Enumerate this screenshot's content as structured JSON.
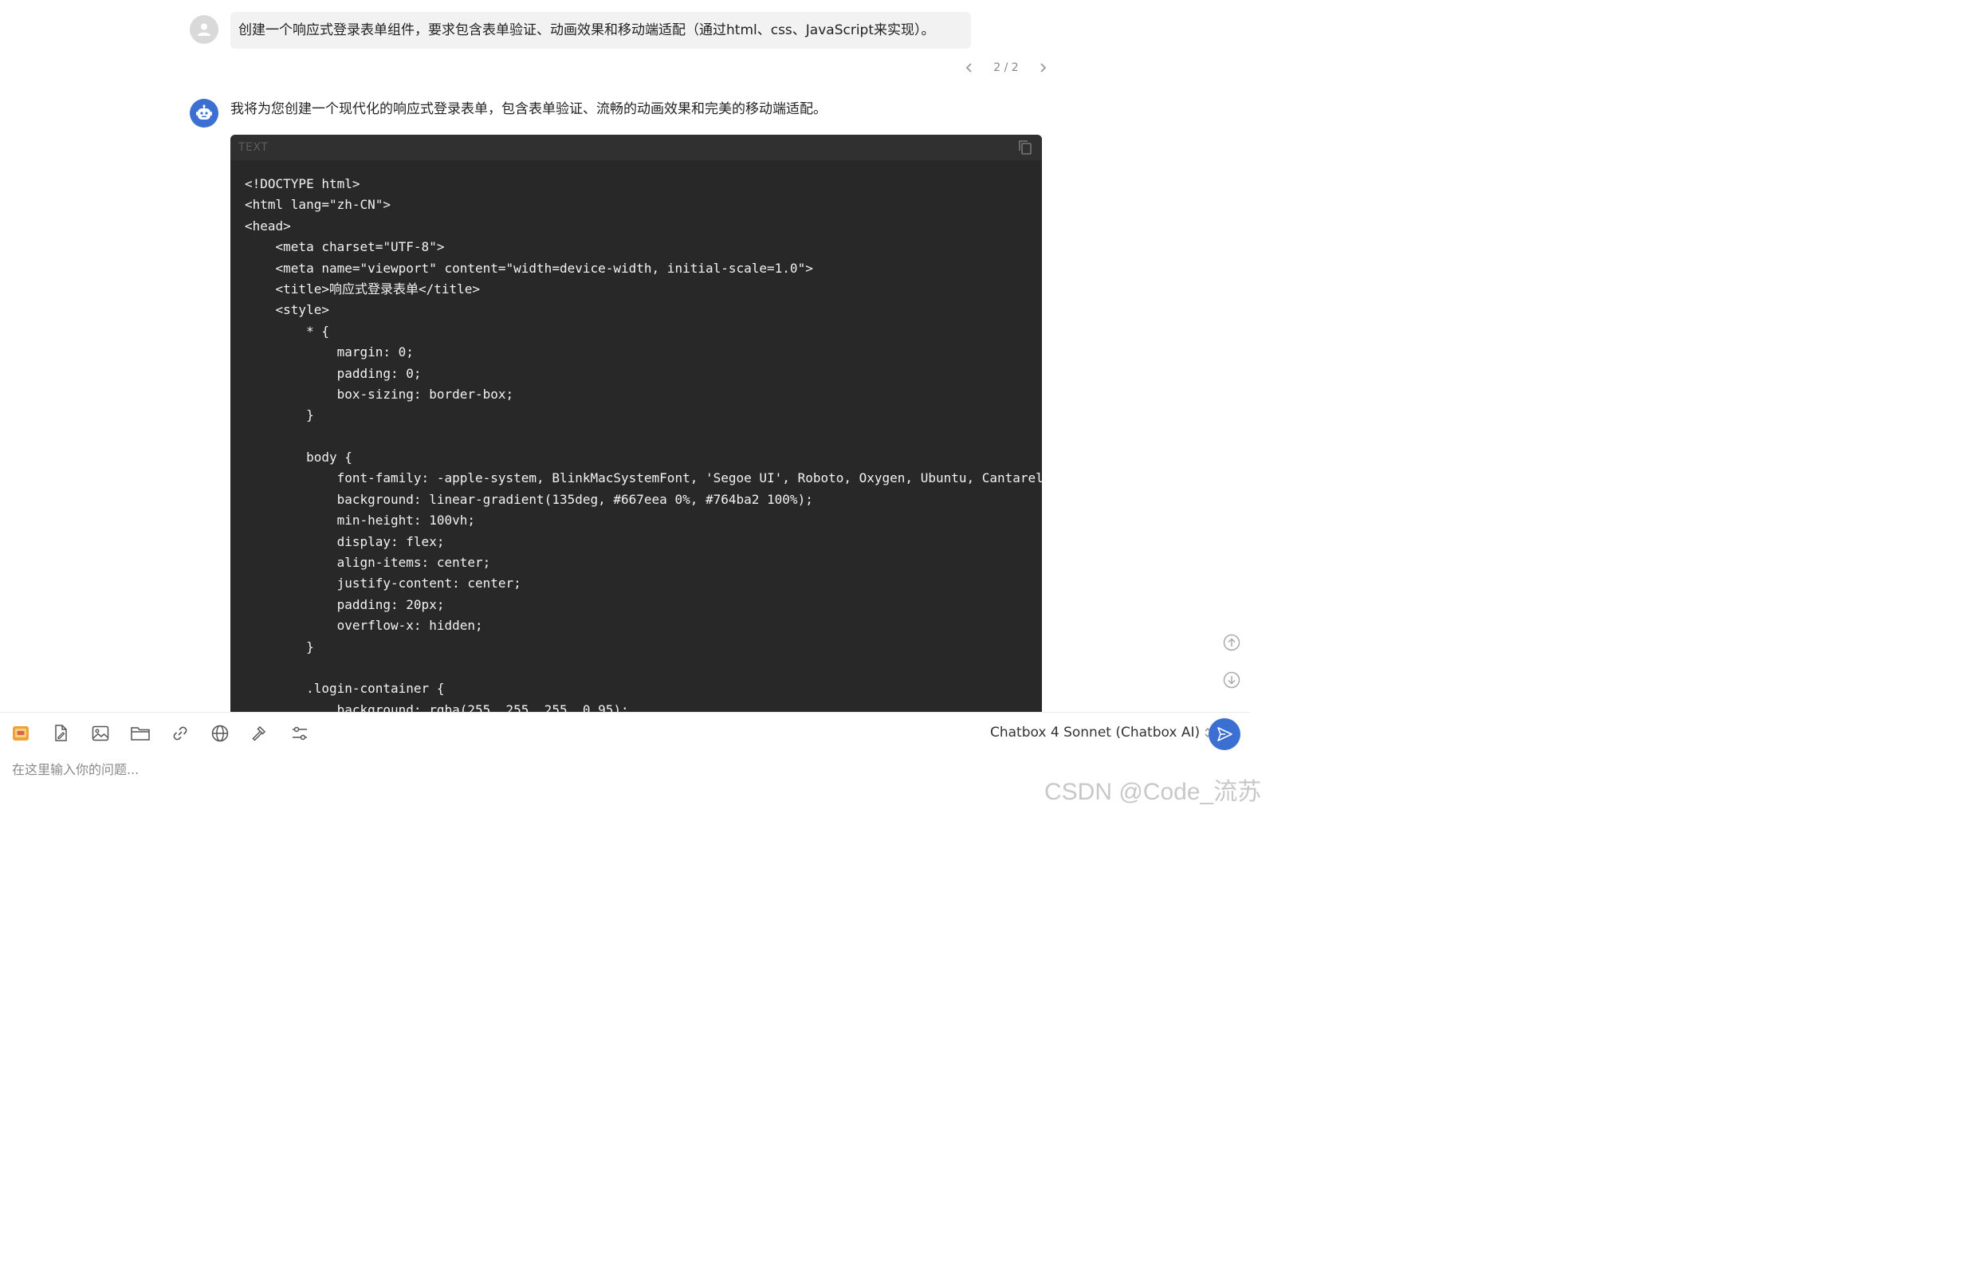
{
  "conversation": {
    "user_message": "创建一个响应式登录表单组件，要求包含表单验证、动画效果和移动端适配（通过html、css、JavaScript来实现）。",
    "pager": {
      "current": 2,
      "total": 2,
      "label": "2 / 2"
    },
    "assistant_intro": "我将为您创建一个现代化的响应式登录表单，包含表单验证、流畅的动画效果和完美的移动端适配。",
    "code_block": {
      "language": "TEXT",
      "lines": [
        "<!DOCTYPE html>",
        "<html lang=\"zh-CN\">",
        "<head>",
        "    <meta charset=\"UTF-8\">",
        "    <meta name=\"viewport\" content=\"width=device-width, initial-scale=1.0\">",
        "    <title>响应式登录表单</title>",
        "    <style>",
        "        * {",
        "            margin: 0;",
        "            padding: 0;",
        "            box-sizing: border-box;",
        "        }",
        "",
        "        body {",
        "            font-family: -apple-system, BlinkMacSystemFont, 'Segoe UI', Roboto, Oxygen, Ubuntu, Cantarell",
        "            background: linear-gradient(135deg, #667eea 0%, #764ba2 100%);",
        "            min-height: 100vh;",
        "            display: flex;",
        "            align-items: center;",
        "            justify-content: center;",
        "            padding: 20px;",
        "            overflow-x: hidden;",
        "        }",
        "",
        "        .login-container {",
        "            background: rgba(255, 255, 255, 0.95);"
      ]
    }
  },
  "input_bar": {
    "tools": [
      {
        "icon": "chatbox-logo-icon"
      },
      {
        "icon": "file-edit-icon"
      },
      {
        "icon": "image-icon"
      },
      {
        "icon": "folder-icon"
      },
      {
        "icon": "link-icon"
      },
      {
        "icon": "globe-icon"
      },
      {
        "icon": "hammer-icon"
      },
      {
        "icon": "settings-sliders-icon"
      }
    ],
    "model_name": "Chatbox 4 Sonnet (Chatbox AI)",
    "placeholder": "在这里输入你的问题..."
  },
  "watermark": "CSDN @Code_流苏",
  "colors": {
    "accent": "#3b6fd1",
    "code_bg": "#282828",
    "user_bubble": "#f2f2f2"
  }
}
